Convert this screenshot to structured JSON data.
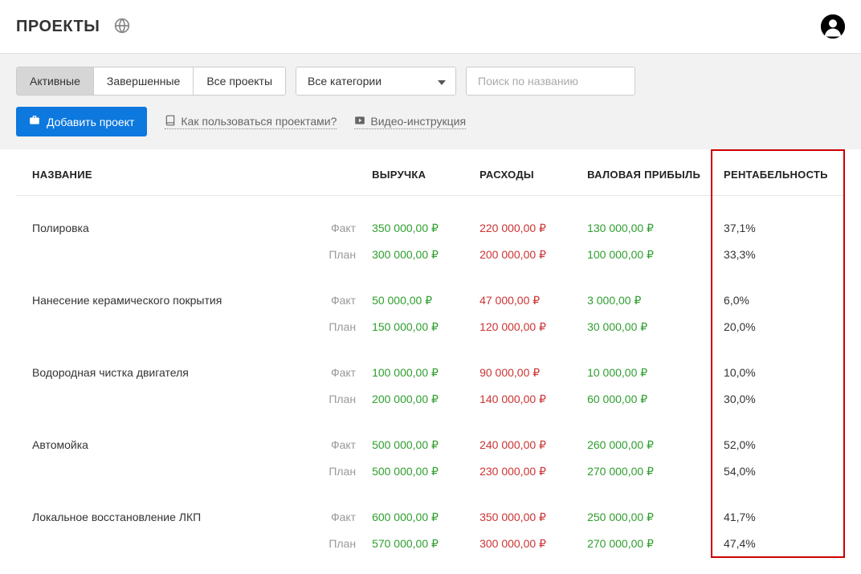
{
  "header": {
    "title": "ПРОЕКТЫ"
  },
  "toolbar": {
    "tabs": [
      "Активные",
      "Завершенные",
      "Все проекты"
    ],
    "category_label": "Все категории",
    "search_placeholder": "Поиск по названию",
    "add_button": "Добавить проект",
    "howto_link": "Как пользоваться проектами?",
    "video_link": "Видео-инструкция"
  },
  "table": {
    "headers": {
      "name": "НАЗВАНИЕ",
      "revenue": "ВЫРУЧКА",
      "expenses": "РАСХОДЫ",
      "gross": "ВАЛОВАЯ ПРИБЫЛЬ",
      "profitability": "РЕНТАБЕЛЬНОСТЬ"
    },
    "row_labels": {
      "fact": "Факт",
      "plan": "План"
    },
    "rows": [
      {
        "name": "Полировка",
        "fact": {
          "revenue": "350 000,00 ₽",
          "expenses": "220 000,00 ₽",
          "gross": "130 000,00 ₽",
          "profitability": "37,1%"
        },
        "plan": {
          "revenue": "300 000,00 ₽",
          "expenses": "200 000,00 ₽",
          "gross": "100 000,00 ₽",
          "profitability": "33,3%"
        }
      },
      {
        "name": "Нанесение керамического покрытия",
        "fact": {
          "revenue": "50 000,00 ₽",
          "expenses": "47 000,00 ₽",
          "gross": "3 000,00 ₽",
          "profitability": "6,0%"
        },
        "plan": {
          "revenue": "150 000,00 ₽",
          "expenses": "120 000,00 ₽",
          "gross": "30 000,00 ₽",
          "profitability": "20,0%"
        }
      },
      {
        "name": "Водородная чистка двигателя",
        "fact": {
          "revenue": "100 000,00 ₽",
          "expenses": "90 000,00 ₽",
          "gross": "10 000,00 ₽",
          "profitability": "10,0%"
        },
        "plan": {
          "revenue": "200 000,00 ₽",
          "expenses": "140 000,00 ₽",
          "gross": "60 000,00 ₽",
          "profitability": "30,0%"
        }
      },
      {
        "name": "Автомойка",
        "fact": {
          "revenue": "500 000,00 ₽",
          "expenses": "240 000,00 ₽",
          "gross": "260 000,00 ₽",
          "profitability": "52,0%"
        },
        "plan": {
          "revenue": "500 000,00 ₽",
          "expenses": "230 000,00 ₽",
          "gross": "270 000,00 ₽",
          "profitability": "54,0%"
        }
      },
      {
        "name": "Локальное восстановление ЛКП",
        "fact": {
          "revenue": "600 000,00 ₽",
          "expenses": "350 000,00 ₽",
          "gross": "250 000,00 ₽",
          "profitability": "41,7%"
        },
        "plan": {
          "revenue": "570 000,00 ₽",
          "expenses": "300 000,00 ₽",
          "gross": "270 000,00 ₽",
          "profitability": "47,4%"
        }
      }
    ]
  }
}
